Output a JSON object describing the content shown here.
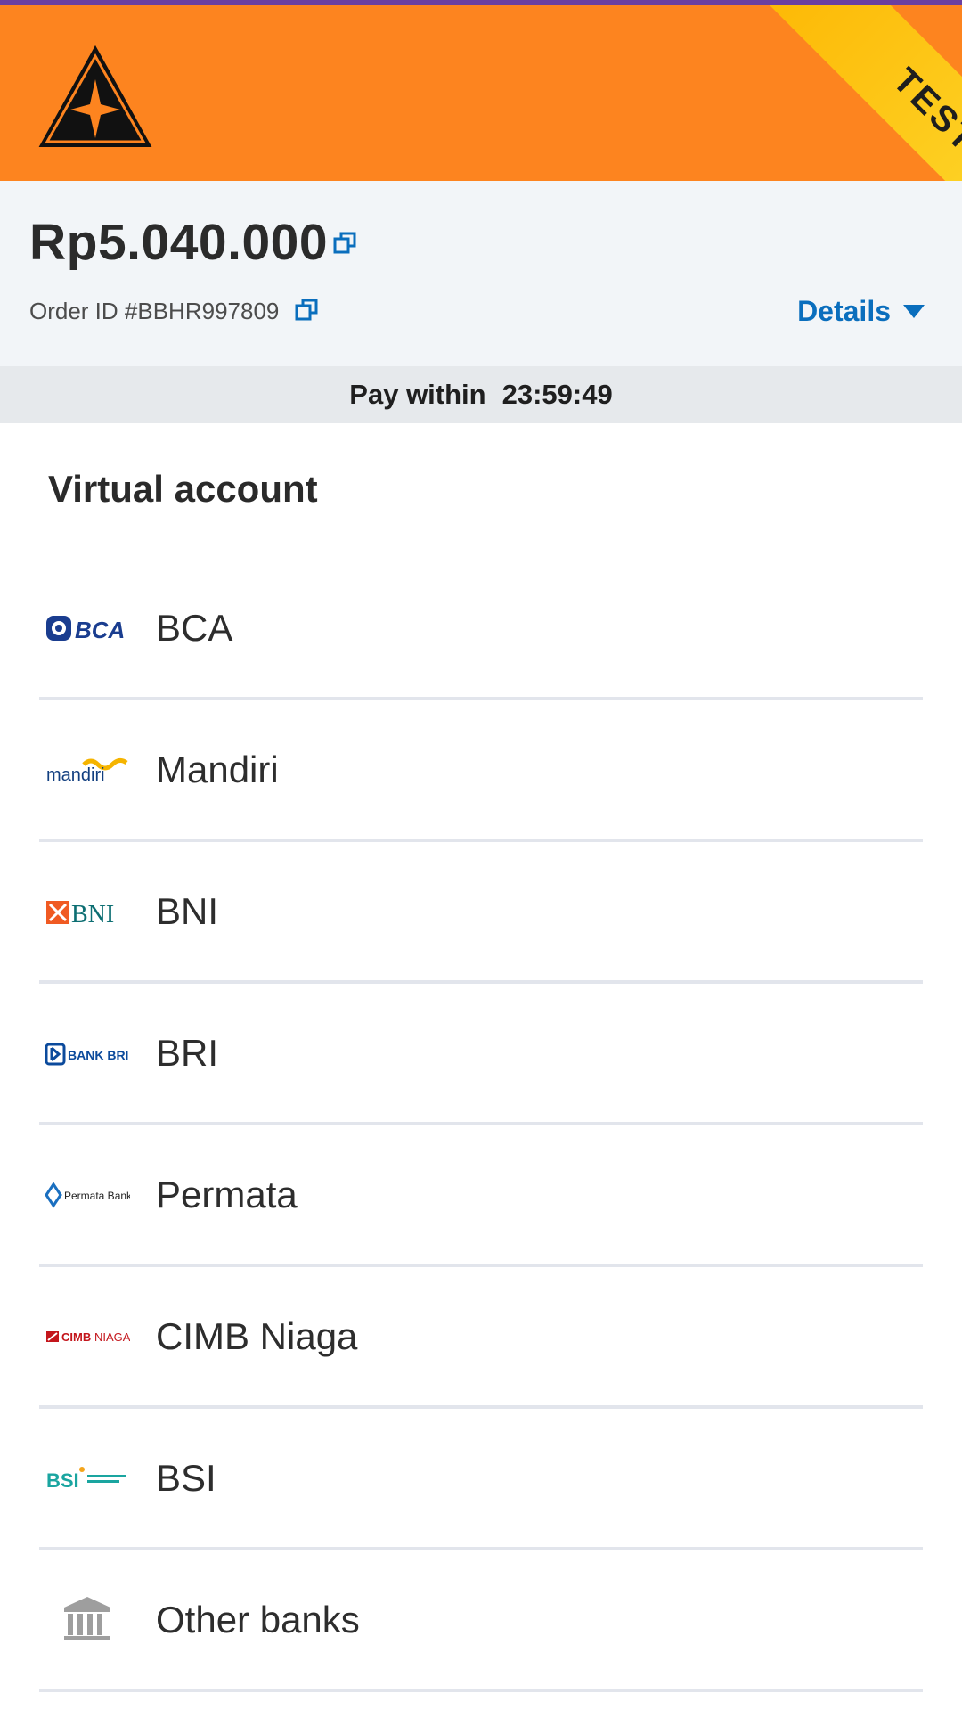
{
  "header": {
    "test_ribbon": "TEST",
    "brand_color": "#fd841f"
  },
  "summary": {
    "amount": "Rp5.040.000",
    "order_id": "Order ID #BBHR997809",
    "details_label": "Details"
  },
  "timer": {
    "label": "Pay within",
    "value": "23:59:49"
  },
  "section": {
    "title": "Virtual account"
  },
  "banks": [
    {
      "name": "BCA",
      "logo": "bca-logo"
    },
    {
      "name": "Mandiri",
      "logo": "mandiri-logo"
    },
    {
      "name": "BNI",
      "logo": "bni-logo"
    },
    {
      "name": "BRI",
      "logo": "bank-bri-logo"
    },
    {
      "name": "Permata",
      "logo": "permata-bank-logo"
    },
    {
      "name": "CIMB Niaga",
      "logo": "cimb-niaga-logo"
    },
    {
      "name": "BSI",
      "logo": "bsi-logo"
    },
    {
      "name": "Other banks",
      "logo": "bank-building-icon"
    }
  ],
  "colors": {
    "accent": "#0a6ebd",
    "divider": "#e2e5ec",
    "timer_bg": "#e6e9ec",
    "summary_bg": "#f2f5f8"
  }
}
